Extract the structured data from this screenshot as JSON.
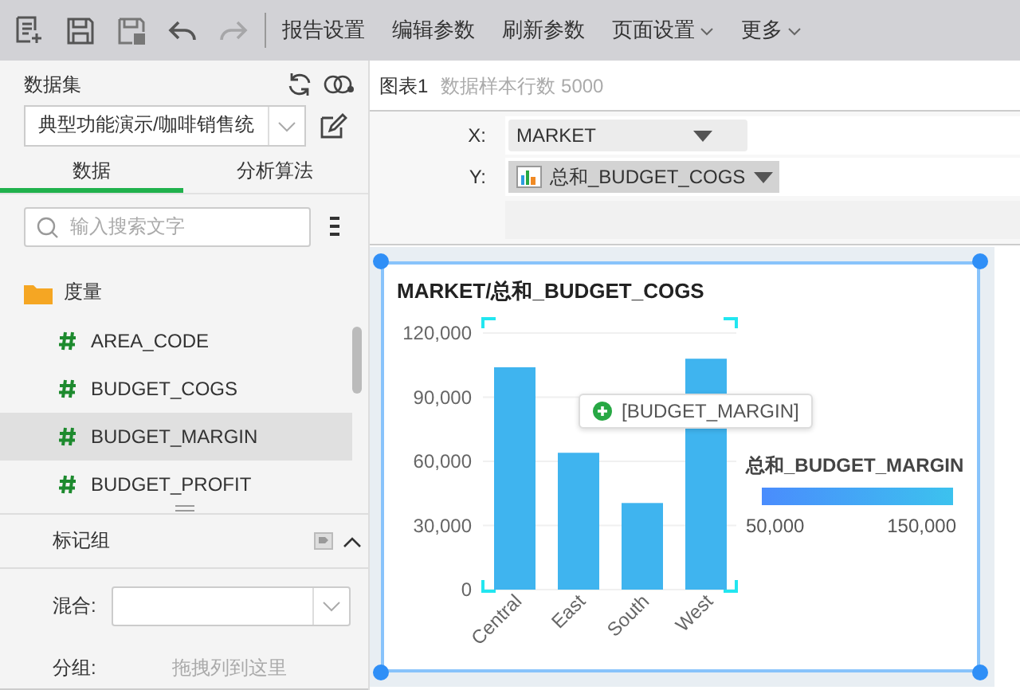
{
  "toolbar": {
    "icons": [
      {
        "kind": "new",
        "disabled": false
      },
      {
        "kind": "save",
        "disabled": false
      },
      {
        "kind": "save-as",
        "disabled": false
      },
      {
        "kind": "undo",
        "disabled": false
      },
      {
        "kind": "redo",
        "disabled": true
      }
    ],
    "menus": [
      {
        "label": "报告设置",
        "dropdown": false
      },
      {
        "label": "编辑参数",
        "dropdown": false
      },
      {
        "label": "刷新参数",
        "dropdown": false
      },
      {
        "label": "页面设置",
        "dropdown": true
      },
      {
        "label": "更多",
        "dropdown": true
      }
    ]
  },
  "dataset": {
    "label": "数据集",
    "value": "典型功能演示/咖啡销售统"
  },
  "tabs": [
    {
      "label": "数据",
      "selected": true
    },
    {
      "label": "分析算法",
      "selected": false
    }
  ],
  "search": {
    "placeholder": "输入搜索文字"
  },
  "tree": [
    {
      "label": "度量",
      "kind": "folder",
      "children": [
        {
          "label": "AREA_CODE",
          "kind": "measure",
          "selected": false
        },
        {
          "label": "BUDGET_COGS",
          "kind": "measure",
          "selected": false
        },
        {
          "label": "BUDGET_MARGIN",
          "kind": "measure",
          "selected": true
        },
        {
          "label": "BUDGET_PROFIT",
          "kind": "measure",
          "selected": false
        }
      ]
    }
  ],
  "marks": {
    "title": "标记组",
    "rows": [
      {
        "label": "混合:",
        "kind": "select"
      },
      {
        "label": "分组:",
        "kind": "drop",
        "placeholder": "拖拽列到这里"
      }
    ]
  },
  "chart_tab": {
    "title": "图表1",
    "info": "数据样本行数 5000"
  },
  "shelves": [
    {
      "label": "X:",
      "field": "MARKET",
      "kind": "dimension"
    },
    {
      "label": "Y:",
      "field": "总和_BUDGET_COGS",
      "kind": "measure"
    }
  ],
  "chart": {
    "title": "MARKET/总和_BUDGET_COGS",
    "tooltip": "[BUDGET_MARGIN]",
    "legend": {
      "title": "总和_BUDGET_MARGIN",
      "min_label": "50,000",
      "max_label": "150,000"
    },
    "chart_data": {
      "type": "bar",
      "categories": [
        "Central",
        "East",
        "South",
        "West"
      ],
      "series": [
        {
          "color": "#3fb4ef",
          "values": [
            104000,
            64000,
            40500,
            108000
          ]
        }
      ],
      "grid": true,
      "ylim": [
        0,
        120000
      ],
      "yticks": [
        {
          "value": 0,
          "label": "0"
        },
        {
          "value": 30000,
          "label": "30,000"
        },
        {
          "value": 60000,
          "label": "60,000"
        },
        {
          "value": 90000,
          "label": "90,000"
        },
        {
          "value": 120000,
          "label": "120,000"
        }
      ]
    }
  }
}
